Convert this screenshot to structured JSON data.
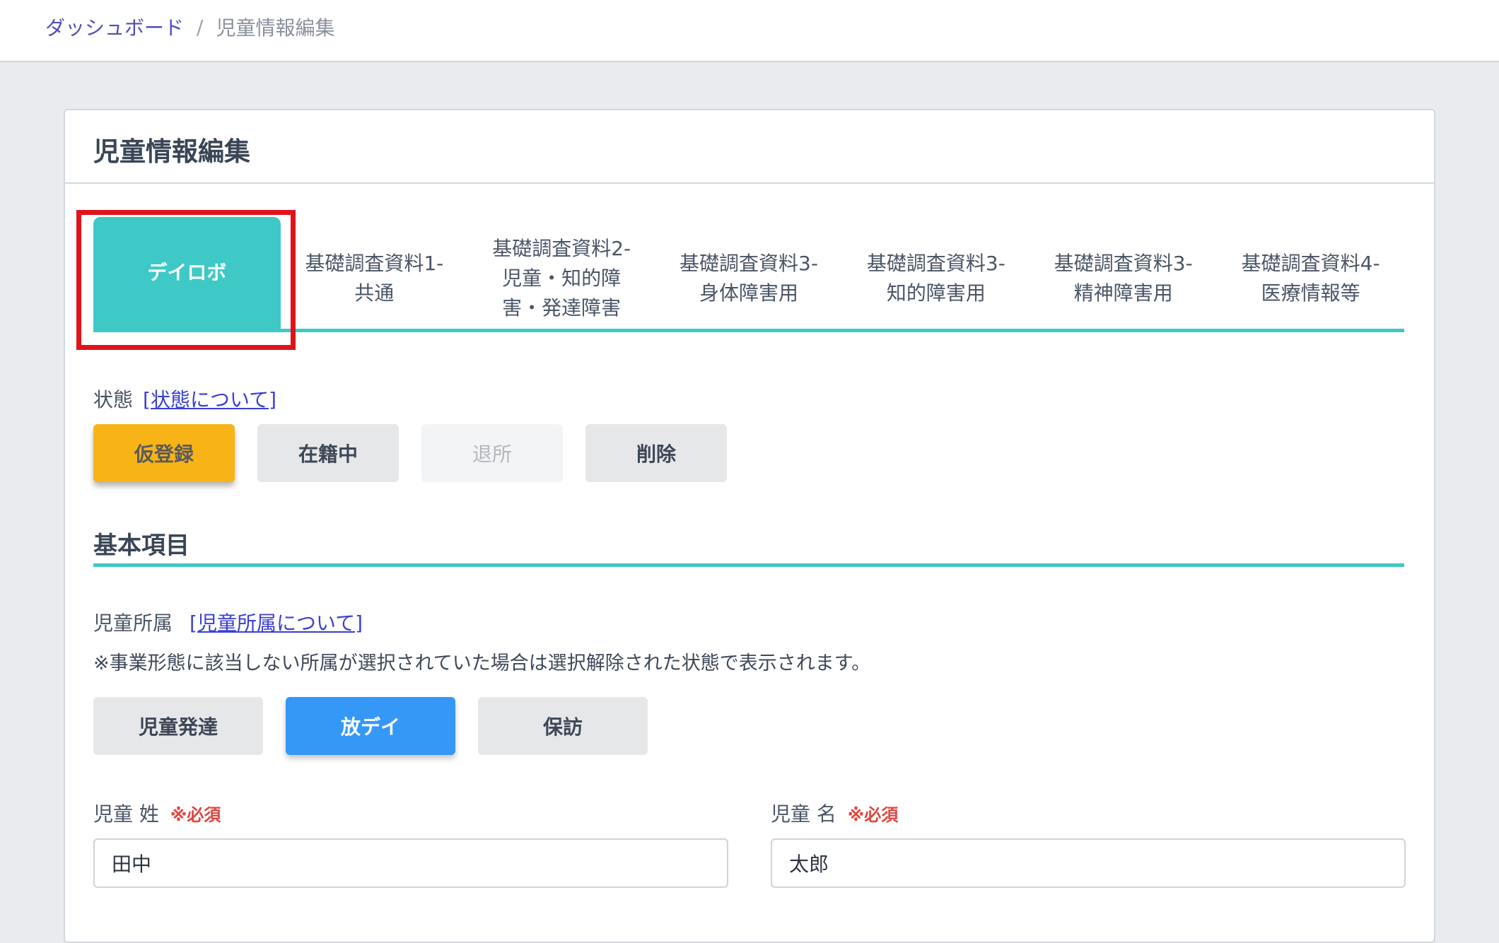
{
  "breadcrumb": {
    "home": "ダッシュボード",
    "separator": "/",
    "current": "児童情報編集"
  },
  "page": {
    "title": "児童情報編集"
  },
  "tabs": [
    {
      "label": "デイロボ",
      "active": true
    },
    {
      "label": "基礎調査資料1-\n共通",
      "active": false
    },
    {
      "label": "基礎調査資料2-\n児童・知的障\n害・発達障害",
      "active": false
    },
    {
      "label": "基礎調査資料3-\n身体障害用",
      "active": false
    },
    {
      "label": "基礎調査資料3-\n知的障害用",
      "active": false
    },
    {
      "label": "基礎調査資料3-\n精神障害用",
      "active": false
    },
    {
      "label": "基礎調査資料4-\n医療情報等",
      "active": false
    }
  ],
  "status": {
    "label": "状態",
    "help_link": "[状態について]",
    "options": [
      {
        "label": "仮登録",
        "state": "selected"
      },
      {
        "label": "在籍中",
        "state": "normal"
      },
      {
        "label": "退所",
        "state": "disabled"
      },
      {
        "label": "削除",
        "state": "normal"
      }
    ]
  },
  "basic": {
    "heading": "基本項目",
    "affiliation_label": "児童所属",
    "affiliation_help_link": "[児童所属について]",
    "affiliation_note": "※事業形態に該当しない所属が選択されていた場合は選択解除された状態で表示されます。",
    "affiliation_options": [
      {
        "label": "児童発達",
        "selected": false
      },
      {
        "label": "放デイ",
        "selected": true
      },
      {
        "label": "保訪",
        "selected": false
      }
    ],
    "last_name_label": "児童 姓",
    "first_name_label": "児童 名",
    "required_mark": "※必須",
    "last_name_value": "田中",
    "first_name_value": "太郎"
  },
  "colors": {
    "accent": "#3ec9c6",
    "selected_status": "#f8b417",
    "selected_affiliation": "#3598f7",
    "highlight": "#e0131b",
    "required": "#e0463f"
  }
}
